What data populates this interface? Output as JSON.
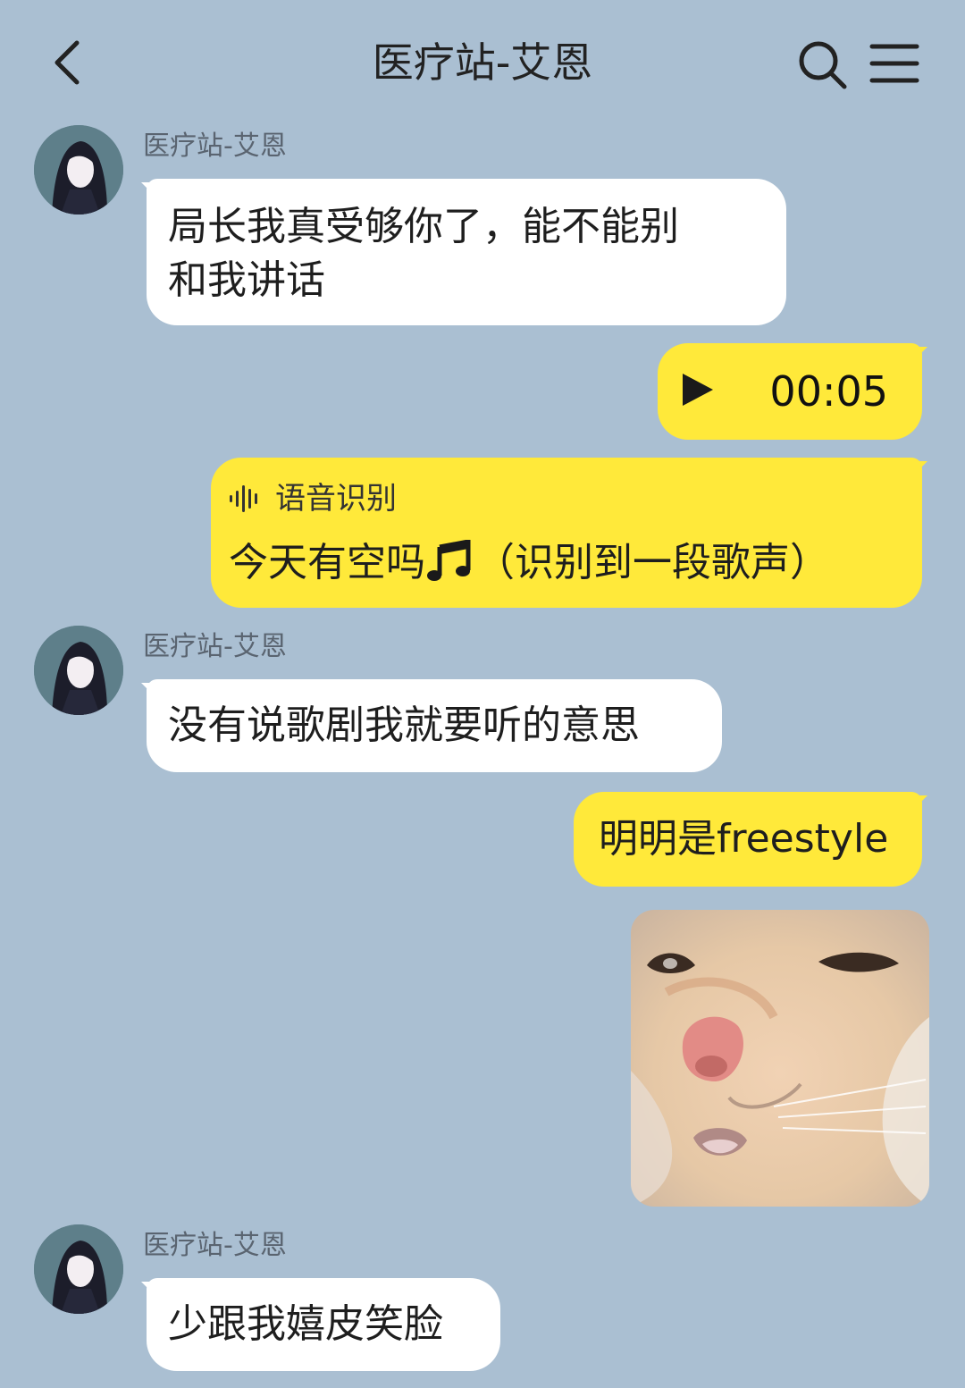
{
  "header": {
    "title": "医疗站-艾恩",
    "back_icon": "chevron-left-icon",
    "search_icon": "search-icon",
    "menu_icon": "hamburger-menu-icon"
  },
  "colors": {
    "background": "#aabfd2",
    "incoming_bubble": "#ffffff",
    "outgoing_bubble": "#ffe93a"
  },
  "messages": [
    {
      "side": "left",
      "sender": "医疗站-艾恩",
      "text_line1": "局长我真受够你了，能不能别",
      "text_line2": "和我讲话"
    },
    {
      "side": "right",
      "type": "voice",
      "play_icon": "play-icon",
      "duration": "00:05"
    },
    {
      "side": "right",
      "type": "speech-recognition",
      "label": "语音识别",
      "icon": "waveform-icon",
      "text_before": "今天有空吗",
      "note_icon": "music-note-icon",
      "text_after": "（识别到一段歌声）"
    },
    {
      "side": "left",
      "sender": "医疗站-艾恩",
      "text": "没有说歌剧我就要听的意思"
    },
    {
      "side": "right",
      "text": "明明是freestyle"
    },
    {
      "side": "right",
      "type": "sticker",
      "content": "smirking-cat-sticker"
    },
    {
      "side": "left",
      "sender": "医疗站-艾恩",
      "text": "少跟我嬉皮笑脸"
    }
  ]
}
